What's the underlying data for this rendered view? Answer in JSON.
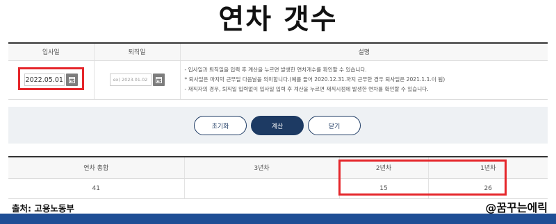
{
  "title": "연차 갯수",
  "form": {
    "headers": {
      "start": "입사일",
      "end": "퇴직일",
      "desc": "설명"
    },
    "start_date_value": "2022.05.01",
    "end_date_placeholder": "ex) 2023.01.02",
    "description": [
      "- 입사일과 퇴직일을 입력 후 계산을 누르면 발생한 연차개수를 확인할 수 있습니다.",
      "* 퇴사일은 마지막 근무일 다음날을 의미합니다.(예를 들어 2020.12.31.까지 근무한 경우 퇴사일은 2021.1.1.이 됨)",
      "- 재직자의 경우, 퇴직일 입력없이 입사일 입력 후 계산을 누르면 재직시점에 발생한 연차를 확인할 수 있습니다."
    ]
  },
  "buttons": {
    "reset": "초기화",
    "calc": "계산",
    "close": "닫기"
  },
  "result": {
    "headers": [
      "연차 총합",
      "3년차",
      "2년차",
      "1년차"
    ],
    "values": [
      "41",
      "",
      "15",
      "26"
    ]
  },
  "footer": {
    "source": "출처: 고용노동부",
    "watermark": "@꿈꾸는에릭"
  },
  "icons": {
    "calendar": "calendar-icon"
  },
  "colors": {
    "accent": "#1d3a63",
    "highlight": "#e5252a",
    "bar": "#1f4e95"
  }
}
